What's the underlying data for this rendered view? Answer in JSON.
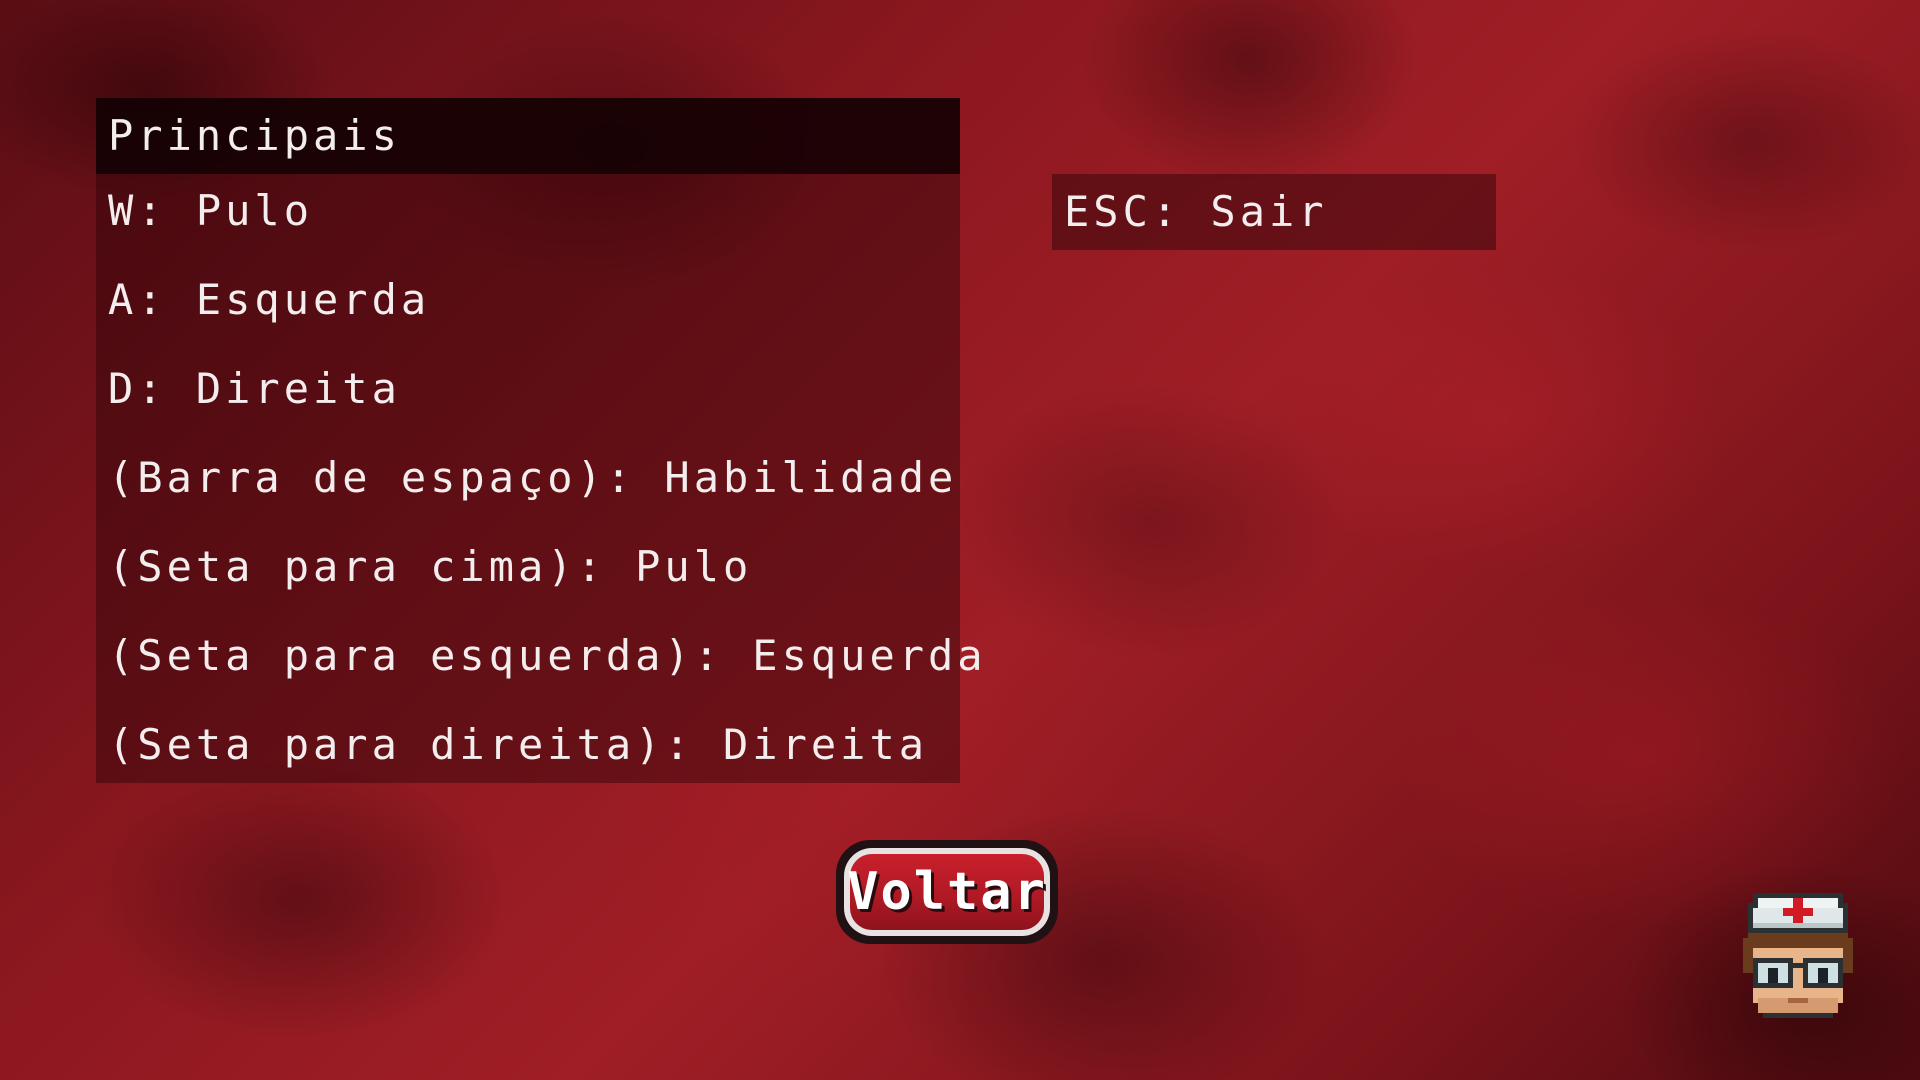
{
  "controls_panel": {
    "header": "Principais",
    "rows": [
      "W: Pulo",
      "A: Esquerda",
      "D: Direita",
      "(Barra de espaço): Habilidade",
      "(Seta para cima): Pulo",
      "(Seta para esquerda): Esquerda",
      "(Seta para direita): Direita"
    ]
  },
  "system_panel": {
    "row": "ESC: Sair"
  },
  "back_button": {
    "label": "Voltar"
  },
  "mascot": {
    "icon": "nurse-character-icon"
  },
  "colors": {
    "background": "#8e1820",
    "panel": "#23030b",
    "text": "#f3eded",
    "button": "#c8202c"
  }
}
